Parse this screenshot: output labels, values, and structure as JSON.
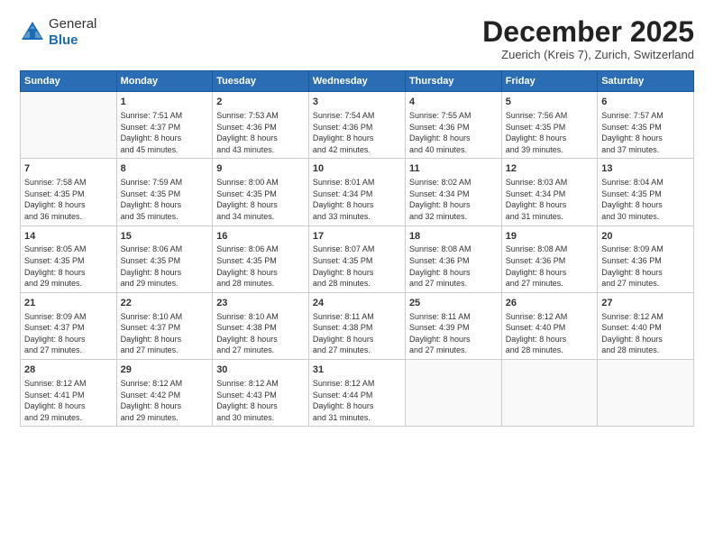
{
  "header": {
    "logo_line1": "General",
    "logo_line2": "Blue",
    "month": "December 2025",
    "location": "Zuerich (Kreis 7), Zurich, Switzerland"
  },
  "weekdays": [
    "Sunday",
    "Monday",
    "Tuesday",
    "Wednesday",
    "Thursday",
    "Friday",
    "Saturday"
  ],
  "weeks": [
    [
      {
        "day": "",
        "info": ""
      },
      {
        "day": "1",
        "info": "Sunrise: 7:51 AM\nSunset: 4:37 PM\nDaylight: 8 hours\nand 45 minutes."
      },
      {
        "day": "2",
        "info": "Sunrise: 7:53 AM\nSunset: 4:36 PM\nDaylight: 8 hours\nand 43 minutes."
      },
      {
        "day": "3",
        "info": "Sunrise: 7:54 AM\nSunset: 4:36 PM\nDaylight: 8 hours\nand 42 minutes."
      },
      {
        "day": "4",
        "info": "Sunrise: 7:55 AM\nSunset: 4:36 PM\nDaylight: 8 hours\nand 40 minutes."
      },
      {
        "day": "5",
        "info": "Sunrise: 7:56 AM\nSunset: 4:35 PM\nDaylight: 8 hours\nand 39 minutes."
      },
      {
        "day": "6",
        "info": "Sunrise: 7:57 AM\nSunset: 4:35 PM\nDaylight: 8 hours\nand 37 minutes."
      }
    ],
    [
      {
        "day": "7",
        "info": "Sunrise: 7:58 AM\nSunset: 4:35 PM\nDaylight: 8 hours\nand 36 minutes."
      },
      {
        "day": "8",
        "info": "Sunrise: 7:59 AM\nSunset: 4:35 PM\nDaylight: 8 hours\nand 35 minutes."
      },
      {
        "day": "9",
        "info": "Sunrise: 8:00 AM\nSunset: 4:35 PM\nDaylight: 8 hours\nand 34 minutes."
      },
      {
        "day": "10",
        "info": "Sunrise: 8:01 AM\nSunset: 4:34 PM\nDaylight: 8 hours\nand 33 minutes."
      },
      {
        "day": "11",
        "info": "Sunrise: 8:02 AM\nSunset: 4:34 PM\nDaylight: 8 hours\nand 32 minutes."
      },
      {
        "day": "12",
        "info": "Sunrise: 8:03 AM\nSunset: 4:34 PM\nDaylight: 8 hours\nand 31 minutes."
      },
      {
        "day": "13",
        "info": "Sunrise: 8:04 AM\nSunset: 4:35 PM\nDaylight: 8 hours\nand 30 minutes."
      }
    ],
    [
      {
        "day": "14",
        "info": "Sunrise: 8:05 AM\nSunset: 4:35 PM\nDaylight: 8 hours\nand 29 minutes."
      },
      {
        "day": "15",
        "info": "Sunrise: 8:06 AM\nSunset: 4:35 PM\nDaylight: 8 hours\nand 29 minutes."
      },
      {
        "day": "16",
        "info": "Sunrise: 8:06 AM\nSunset: 4:35 PM\nDaylight: 8 hours\nand 28 minutes."
      },
      {
        "day": "17",
        "info": "Sunrise: 8:07 AM\nSunset: 4:35 PM\nDaylight: 8 hours\nand 28 minutes."
      },
      {
        "day": "18",
        "info": "Sunrise: 8:08 AM\nSunset: 4:36 PM\nDaylight: 8 hours\nand 27 minutes."
      },
      {
        "day": "19",
        "info": "Sunrise: 8:08 AM\nSunset: 4:36 PM\nDaylight: 8 hours\nand 27 minutes."
      },
      {
        "day": "20",
        "info": "Sunrise: 8:09 AM\nSunset: 4:36 PM\nDaylight: 8 hours\nand 27 minutes."
      }
    ],
    [
      {
        "day": "21",
        "info": "Sunrise: 8:09 AM\nSunset: 4:37 PM\nDaylight: 8 hours\nand 27 minutes."
      },
      {
        "day": "22",
        "info": "Sunrise: 8:10 AM\nSunset: 4:37 PM\nDaylight: 8 hours\nand 27 minutes."
      },
      {
        "day": "23",
        "info": "Sunrise: 8:10 AM\nSunset: 4:38 PM\nDaylight: 8 hours\nand 27 minutes."
      },
      {
        "day": "24",
        "info": "Sunrise: 8:11 AM\nSunset: 4:38 PM\nDaylight: 8 hours\nand 27 minutes."
      },
      {
        "day": "25",
        "info": "Sunrise: 8:11 AM\nSunset: 4:39 PM\nDaylight: 8 hours\nand 27 minutes."
      },
      {
        "day": "26",
        "info": "Sunrise: 8:12 AM\nSunset: 4:40 PM\nDaylight: 8 hours\nand 28 minutes."
      },
      {
        "day": "27",
        "info": "Sunrise: 8:12 AM\nSunset: 4:40 PM\nDaylight: 8 hours\nand 28 minutes."
      }
    ],
    [
      {
        "day": "28",
        "info": "Sunrise: 8:12 AM\nSunset: 4:41 PM\nDaylight: 8 hours\nand 29 minutes."
      },
      {
        "day": "29",
        "info": "Sunrise: 8:12 AM\nSunset: 4:42 PM\nDaylight: 8 hours\nand 29 minutes."
      },
      {
        "day": "30",
        "info": "Sunrise: 8:12 AM\nSunset: 4:43 PM\nDaylight: 8 hours\nand 30 minutes."
      },
      {
        "day": "31",
        "info": "Sunrise: 8:12 AM\nSunset: 4:44 PM\nDaylight: 8 hours\nand 31 minutes."
      },
      {
        "day": "",
        "info": ""
      },
      {
        "day": "",
        "info": ""
      },
      {
        "day": "",
        "info": ""
      }
    ]
  ]
}
